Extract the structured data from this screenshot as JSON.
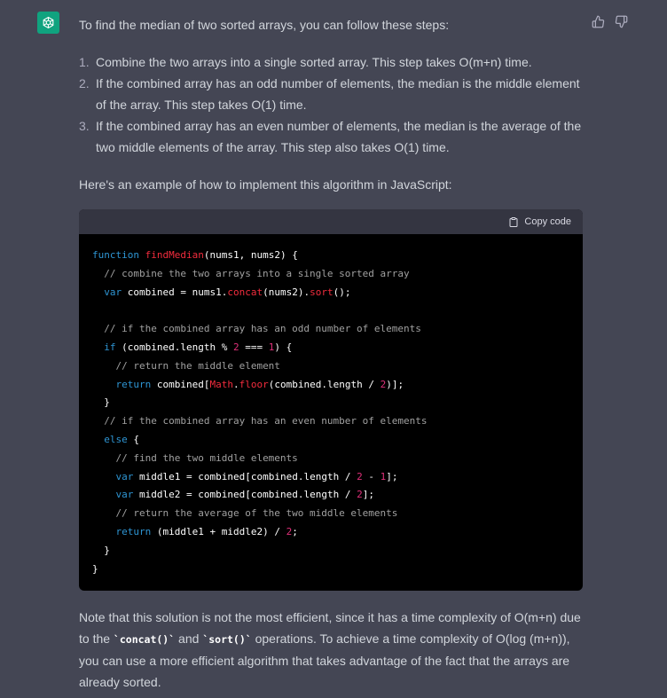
{
  "avatar": {
    "icon": "openai-logo-icon",
    "color": "#10a37f"
  },
  "feedback": {
    "thumbs_up_icon": "thumbs-up-icon",
    "thumbs_down_icon": "thumbs-down-icon"
  },
  "message": {
    "intro": "To find the median of two sorted arrays, you can follow these steps:",
    "steps": [
      {
        "num": "1.",
        "text": "Combine the two arrays into a single sorted array. This step takes O(m+n) time."
      },
      {
        "num": "2.",
        "text": "If the combined array has an odd number of elements, the median is the middle element of the array. This step takes O(1) time."
      },
      {
        "num": "3.",
        "text": "If the combined array has an even number of elements, the median is the average of the two middle elements of the array. This step also takes O(1) time."
      }
    ],
    "example_intro": "Here's an example of how to implement this algorithm in JavaScript:",
    "code_block": {
      "copy_label": "Copy code",
      "language": "JavaScript",
      "lines": [
        "function findMedian(nums1, nums2) {",
        "  // combine the two arrays into a single sorted array",
        "  var combined = nums1.concat(nums2).sort();",
        "",
        "  // if the combined array has an odd number of elements",
        "  if (combined.length % 2 === 1) {",
        "    // return the middle element",
        "    return combined[Math.floor(combined.length / 2)];",
        "  }",
        "  // if the combined array has an even number of elements",
        "  else {",
        "    // find the two middle elements",
        "    var middle1 = combined[combined.length / 2 - 1];",
        "    var middle2 = combined[combined.length / 2];",
        "    // return the average of the two middle elements",
        "    return (middle1 + middle2) / 2;",
        "  }",
        "}"
      ]
    },
    "note": {
      "part1": "Note that this solution is not the most efficient, since it has a time complexity of O(m+n) due to the ",
      "code1": "`concat()`",
      "part2": " and ",
      "code2": "`sort()`",
      "part3": " operations. To achieve a time complexity of O(log (m+n)), you can use a more efficient algorithm that takes advantage of the fact that the arrays are already sorted."
    }
  },
  "colors": {
    "background": "#444654",
    "text": "#d1d5db",
    "code_bg": "#000000",
    "code_header_bg": "#343541",
    "keyword": "#2e95d3",
    "function": "#f22c3d",
    "comment": "#a0a0a0",
    "number": "#df3079"
  }
}
